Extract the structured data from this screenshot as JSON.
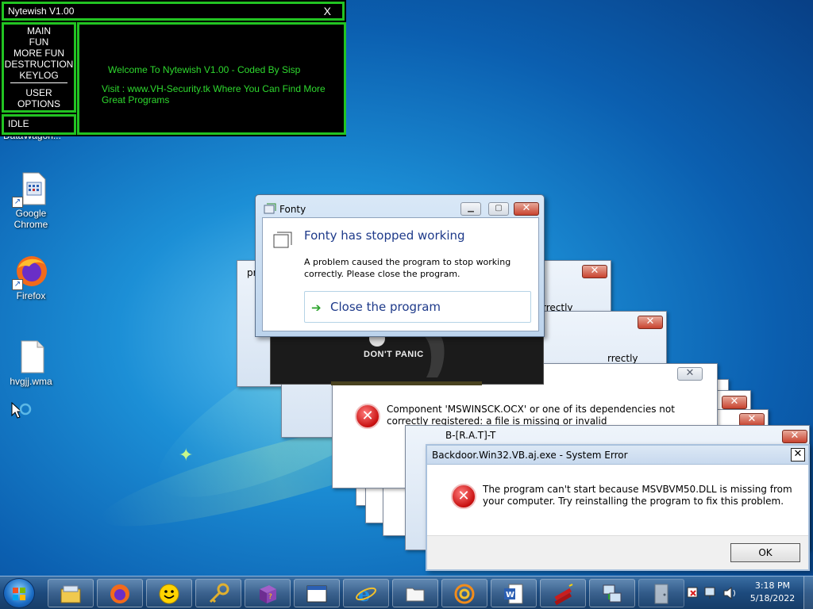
{
  "nytewish": {
    "title": "Nytewish V1.00",
    "close": "X",
    "menu": [
      "MAIN",
      "FUN",
      "MORE FUN",
      "DESTRUCTION",
      "KEYLOG",
      "USER",
      "OPTIONS"
    ],
    "status": "IDLE",
    "welcome": "Welcome To Nytewish V1.00 - Coded By Sisp",
    "visit": "Visit : www.VH-Security.tk Where You Can Find More Great Programs"
  },
  "desktop": {
    "partial_label": "DataWagon...",
    "icons": [
      {
        "label": "Google Chrome",
        "icon": "document-shortcut-icon"
      },
      {
        "label": "Firefox",
        "icon": "firefox-icon"
      },
      {
        "label": "hvgjj.wma",
        "icon": "blank-file-icon"
      }
    ]
  },
  "fonty": {
    "title": "Fonty",
    "heading": "Fonty has stopped working",
    "description": "A problem caused the program to stop working correctly. Please close the program.",
    "close_label": "Close the program"
  },
  "panic_image": {
    "text": "DON'T PANIC"
  },
  "background_windows": {
    "pr_caption": "pr",
    "correctly_1": "rrectly",
    "correctly_2": "rrectly",
    "component_error": "Component 'MSWINSCK.OCX' or one of its dependencies not correctly registered: a file is missing or invalid",
    "birat_caption": "B-[R.A.T]-T"
  },
  "backdoor": {
    "title": "Backdoor.Win32.VB.aj.exe - System Error",
    "message": "The program can't start because MSVBVM50.DLL is missing from your computer. Try reinstalling the program to fix this problem.",
    "ok": "OK"
  },
  "taskbar": {
    "buttons": [
      "explorer-icon",
      "firefox-icon",
      "smiley-icon",
      "key-icon",
      "help-book-icon",
      "window-icon",
      "internet-explorer-icon",
      "folder-icon",
      "spiral-icon",
      "word-document-icon",
      "dynamite-icon",
      "network-computer-icon",
      "door-icon"
    ],
    "time": "3:18 PM",
    "date": "5/18/2022"
  },
  "colors": {
    "nytewish_green": "#22c322",
    "nytewish_text": "#2ed82e",
    "error_red": "#c80f0f",
    "fonty_heading": "#1e3a8a"
  }
}
